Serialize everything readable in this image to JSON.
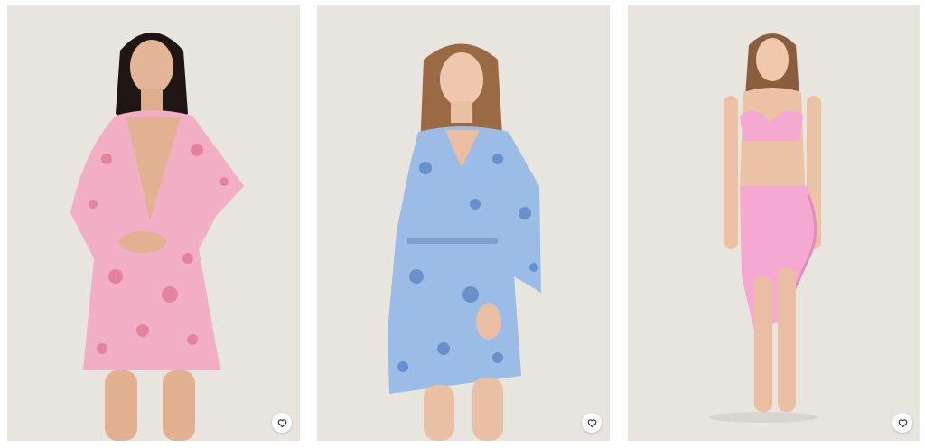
{
  "products": [
    {
      "image_alt": "Model wearing pink floral print wrap dress",
      "wishlist_label": "Add to wishlist",
      "icon": "heart-outline-icon",
      "colors": {
        "background": "#e8e4de",
        "garment": "#f1aec4",
        "pattern": "#d9607f"
      }
    },
    {
      "image_alt": "Model wearing blue floral print kaftan dress",
      "wishlist_label": "Add to wishlist",
      "icon": "heart-outline-icon",
      "colors": {
        "background": "#e8e4de",
        "garment": "#9bbce6",
        "pattern": "#3e6db8"
      }
    },
    {
      "image_alt": "Model wearing pink bikini top and ruffle sarong skirt",
      "wishlist_label": "Add to wishlist",
      "icon": "heart-outline-icon",
      "colors": {
        "background": "#e8e4de",
        "garment": "#f5a8d2",
        "pattern": "#e48bbd"
      }
    }
  ]
}
